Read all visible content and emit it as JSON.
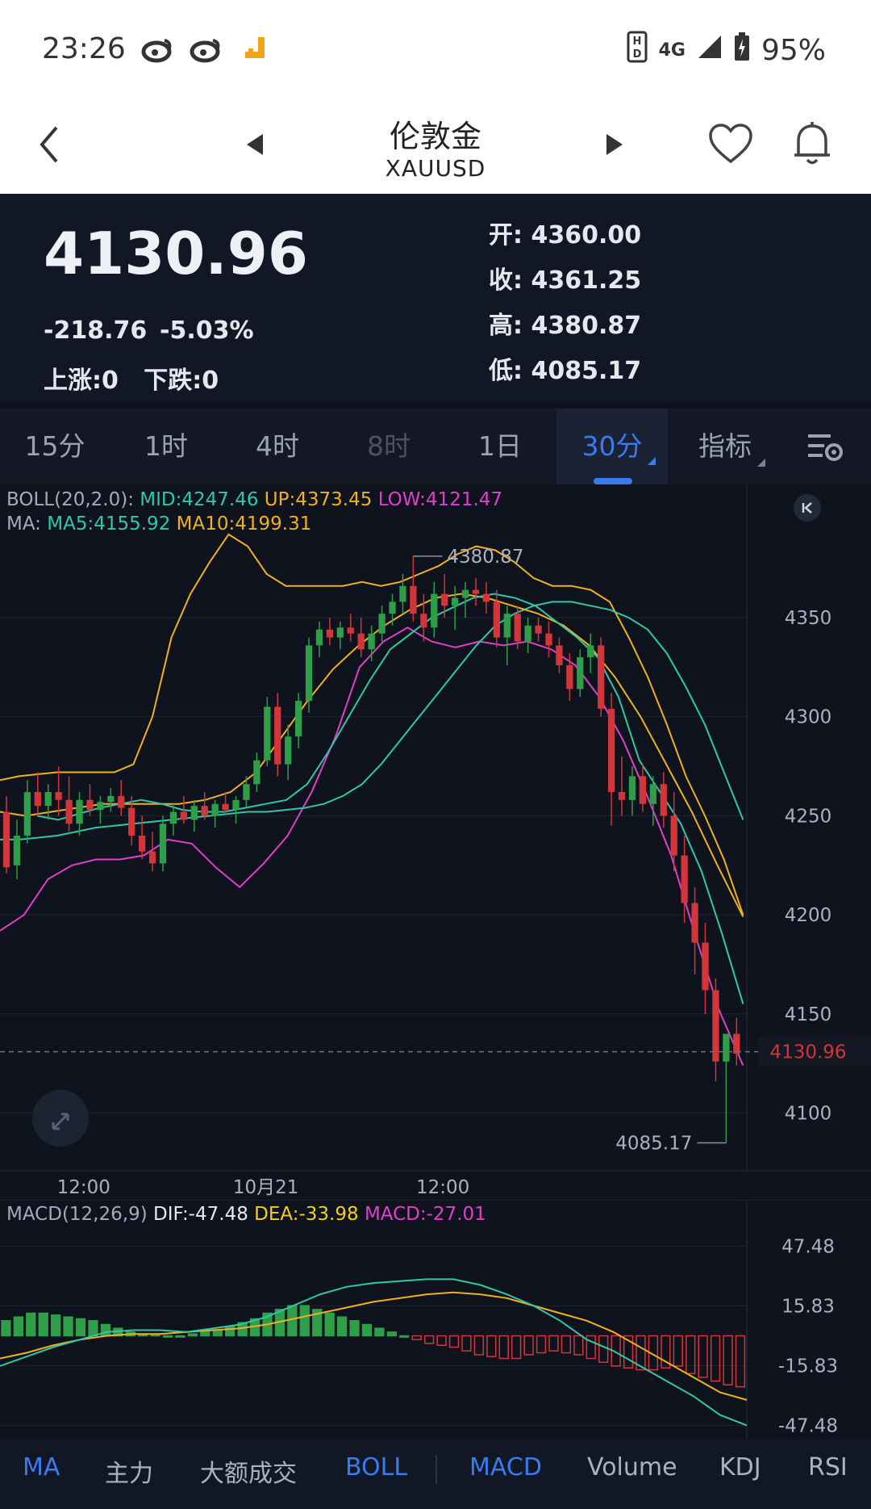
{
  "status": {
    "time": "23:26",
    "battery": "95%",
    "network": "4G"
  },
  "header": {
    "title": "伦敦金",
    "symbol": "XAUUSD"
  },
  "quote": {
    "price": "4130.96",
    "change": "-218.76",
    "change_pct": "-5.03%",
    "updown": "上涨:0   下跌:0",
    "open_label": "开:",
    "open": "4360.00",
    "close_label": "收:",
    "close": "4361.25",
    "high_label": "高:",
    "high": "4380.87",
    "low_label": "低:",
    "low": "4085.17"
  },
  "tabs": [
    {
      "label": "15分",
      "state": "normal"
    },
    {
      "label": "1时",
      "state": "normal"
    },
    {
      "label": "4时",
      "state": "normal"
    },
    {
      "label": "8时",
      "state": "disabled"
    },
    {
      "label": "1日",
      "state": "normal"
    },
    {
      "label": "30分",
      "state": "active"
    },
    {
      "label": "指标",
      "state": "normal"
    }
  ],
  "legend": {
    "boll_name": "BOLL(20,2.0):",
    "boll_mid": "MID:4247.46",
    "boll_up": "UP:4373.45",
    "boll_low": "LOW:4121.47",
    "ma_name": "MA:",
    "ma5": "MA5:4155.92",
    "ma10": "MA10:4199.31",
    "macd_name": "MACD(12,26,9)",
    "dif": "DIF:-47.48",
    "dea": "DEA:-33.98",
    "macd": "MACD:-27.01"
  },
  "colors": {
    "up": "#2e9e48",
    "down": "#d2363a",
    "mid": "#2fc8a8",
    "upper": "#f0b020",
    "lower": "#e040c8",
    "ma5": "#2fc8a8",
    "ma10": "#f0b020",
    "accent": "#3a7bf0"
  },
  "bottom_tabs": [
    {
      "label": "MA",
      "active": true
    },
    {
      "label": "主力",
      "active": false
    },
    {
      "label": "大额成交",
      "active": false
    },
    {
      "label": "BOLL",
      "active": true
    },
    {
      "label": "MACD",
      "active": true
    },
    {
      "label": "Volume",
      "active": false
    },
    {
      "label": "KDJ",
      "active": false
    },
    {
      "label": "RSI",
      "active": false
    }
  ],
  "chart_data": [
    {
      "type": "candlestick",
      "y_ticks": [
        "4350",
        "4300",
        "4250",
        "4200",
        "4150",
        "4100"
      ],
      "x_ticks": [
        "12:00",
        "10月21",
        "12:00"
      ],
      "ylim": [
        4075,
        4405
      ],
      "current_price": "4130.96",
      "high_marker": "4380.87",
      "low_marker": "4085.17",
      "ohlc": [
        [
          4252,
          4260,
          4221,
          4224
        ],
        [
          4225,
          4248,
          4218,
          4240
        ],
        [
          4240,
          4268,
          4236,
          4262
        ],
        [
          4262,
          4272,
          4250,
          4255
        ],
        [
          4255,
          4266,
          4248,
          4262
        ],
        [
          4262,
          4275,
          4250,
          4258
        ],
        [
          4258,
          4270,
          4242,
          4246
        ],
        [
          4246,
          4262,
          4240,
          4258
        ],
        [
          4258,
          4266,
          4250,
          4253
        ],
        [
          4253,
          4260,
          4246,
          4257
        ],
        [
          4257,
          4264,
          4252,
          4260
        ],
        [
          4260,
          4268,
          4250,
          4254
        ],
        [
          4254,
          4260,
          4235,
          4240
        ],
        [
          4240,
          4250,
          4228,
          4232
        ],
        [
          4232,
          4242,
          4222,
          4226
        ],
        [
          4226,
          4250,
          4222,
          4246
        ],
        [
          4246,
          4256,
          4240,
          4252
        ],
        [
          4252,
          4260,
          4246,
          4248
        ],
        [
          4248,
          4258,
          4242,
          4255
        ],
        [
          4255,
          4262,
          4248,
          4250
        ],
        [
          4250,
          4258,
          4244,
          4256
        ],
        [
          4256,
          4262,
          4250,
          4253
        ],
        [
          4253,
          4260,
          4246,
          4258
        ],
        [
          4258,
          4270,
          4254,
          4266
        ],
        [
          4266,
          4282,
          4262,
          4278
        ],
        [
          4278,
          4310,
          4275,
          4305
        ],
        [
          4305,
          4312,
          4270,
          4276
        ],
        [
          4276,
          4296,
          4268,
          4290
        ],
        [
          4290,
          4312,
          4284,
          4308
        ],
        [
          4308,
          4340,
          4302,
          4336
        ],
        [
          4336,
          4348,
          4330,
          4344
        ],
        [
          4344,
          4350,
          4336,
          4340
        ],
        [
          4340,
          4348,
          4334,
          4345
        ],
        [
          4345,
          4352,
          4338,
          4342
        ],
        [
          4342,
          4350,
          4330,
          4334
        ],
        [
          4334,
          4346,
          4328,
          4342
        ],
        [
          4342,
          4356,
          4338,
          4352
        ],
        [
          4352,
          4362,
          4346,
          4358
        ],
        [
          4358,
          4372,
          4352,
          4366
        ],
        [
          4366,
          4381,
          4348,
          4352
        ],
        [
          4352,
          4362,
          4338,
          4345
        ],
        [
          4345,
          4368,
          4340,
          4362
        ],
        [
          4362,
          4372,
          4350,
          4356
        ],
        [
          4356,
          4366,
          4344,
          4360
        ],
        [
          4360,
          4368,
          4350,
          4364
        ],
        [
          4364,
          4370,
          4356,
          4362
        ],
        [
          4362,
          4368,
          4352,
          4358
        ],
        [
          4358,
          4364,
          4335,
          4340
        ],
        [
          4340,
          4356,
          4326,
          4352
        ],
        [
          4352,
          4356,
          4334,
          4338
        ],
        [
          4338,
          4350,
          4332,
          4346
        ],
        [
          4346,
          4350,
          4338,
          4342
        ],
        [
          4342,
          4348,
          4330,
          4336
        ],
        [
          4336,
          4340,
          4322,
          4326
        ],
        [
          4326,
          4332,
          4308,
          4314
        ],
        [
          4314,
          4334,
          4310,
          4330
        ],
        [
          4330,
          4342,
          4322,
          4336
        ],
        [
          4336,
          4340,
          4300,
          4304
        ],
        [
          4304,
          4312,
          4245,
          4262
        ],
        [
          4262,
          4280,
          4250,
          4258
        ],
        [
          4258,
          4275,
          4250,
          4270
        ],
        [
          4270,
          4276,
          4252,
          4256
        ],
        [
          4256,
          4270,
          4245,
          4266
        ],
        [
          4266,
          4272,
          4244,
          4250
        ],
        [
          4250,
          4262,
          4222,
          4230
        ],
        [
          4230,
          4240,
          4196,
          4206
        ],
        [
          4206,
          4214,
          4170,
          4186
        ],
        [
          4186,
          4196,
          4150,
          4162
        ],
        [
          4162,
          4168,
          4116,
          4126
        ],
        [
          4126,
          4138,
          4085,
          4140
        ],
        [
          4140,
          4148,
          4124,
          4130
        ]
      ],
      "mid": [
        4238,
        4238,
        4239,
        4240,
        4242,
        4244,
        4245,
        4246,
        4247,
        4248,
        4249,
        4250,
        4251,
        4252,
        4252,
        4253,
        4254,
        4256,
        4260,
        4266,
        4276,
        4288,
        4300,
        4312,
        4324,
        4336,
        4346,
        4352,
        4356,
        4358,
        4358,
        4356,
        4354,
        4350,
        4344,
        4332,
        4315,
        4296,
        4272,
        4248
      ],
      "upper": [
        4268,
        4270,
        4271,
        4272,
        4272,
        4272,
        4272,
        4276,
        4300,
        4340,
        4362,
        4378,
        4392,
        4386,
        4372,
        4366,
        4366,
        4366,
        4366,
        4368,
        4366,
        4368,
        4372,
        4376,
        4382,
        4386,
        4384,
        4378,
        4370,
        4366,
        4366,
        4364,
        4358,
        4340,
        4320,
        4296,
        4270,
        4250,
        4228,
        4200
      ],
      "lower": [
        4192,
        4200,
        4218,
        4225,
        4228,
        4228,
        4230,
        4238,
        4236,
        4224,
        4214,
        4226,
        4240,
        4262,
        4290,
        4325,
        4338,
        4345,
        4338,
        4335,
        4338,
        4336,
        4338,
        4334,
        4326,
        4310,
        4288,
        4260,
        4230,
        4190,
        4152,
        4124
      ],
      "ma5": [
        4250,
        4248,
        4251,
        4254,
        4256,
        4258,
        4256,
        4253,
        4252,
        4252,
        4254,
        4256,
        4258,
        4266,
        4282,
        4300,
        4318,
        4334,
        4342,
        4350,
        4355,
        4360,
        4362,
        4360,
        4356,
        4348,
        4340,
        4330,
        4310,
        4278,
        4262,
        4246,
        4222,
        4190,
        4155
      ],
      "ma10": [
        4252,
        4250,
        4252,
        4254,
        4256,
        4256,
        4256,
        4256,
        4258,
        4262,
        4272,
        4290,
        4308,
        4324,
        4336,
        4346,
        4354,
        4360,
        4362,
        4360,
        4356,
        4352,
        4346,
        4336,
        4320,
        4300,
        4276,
        4252,
        4225,
        4199
      ]
    },
    {
      "type": "macd",
      "y_ticks": [
        "47.48",
        "15.83",
        "-15.83",
        "-47.48"
      ],
      "ylim": [
        -52,
        55
      ],
      "dif": [
        -16,
        -11,
        -6,
        -2,
        2,
        3,
        3,
        2,
        4,
        6,
        10,
        16,
        22,
        26,
        28,
        29,
        30,
        30,
        27,
        22,
        16,
        8,
        -2,
        -8,
        -16,
        -24,
        -32,
        -42,
        -47.48
      ],
      "dea": [
        -12,
        -9,
        -5,
        -2,
        0,
        1,
        1,
        2,
        3,
        4,
        6,
        9,
        12,
        15,
        18,
        20,
        22,
        23,
        22,
        20,
        16,
        12,
        8,
        2,
        -6,
        -14,
        -22,
        -30,
        -33.98
      ],
      "hist": [
        8,
        10,
        12,
        12,
        11,
        10,
        9,
        8,
        6,
        4,
        2,
        1,
        1,
        0,
        0,
        1,
        2,
        3,
        5,
        7,
        9,
        12,
        14,
        16,
        16,
        14,
        12,
        10,
        8,
        6,
        4,
        2,
        0,
        -2,
        -4,
        -5,
        -6,
        -8,
        -10,
        -11,
        -12,
        -12,
        -10,
        -9,
        -8,
        -9,
        -10,
        -12,
        -14,
        -16,
        -17,
        -18,
        -18,
        -17,
        -16,
        -20,
        -22,
        -24,
        -26,
        -27.01
      ]
    }
  ]
}
